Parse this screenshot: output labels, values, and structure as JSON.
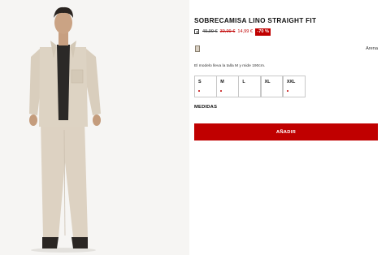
{
  "product": {
    "title": "SOBRECAMISA LINO STRAIGHT FIT",
    "price_original": "49,99 €",
    "price_previous": "39,99 €",
    "price_current": "14,99 €",
    "discount": "-70 %",
    "color_name": "Arena",
    "model_info": "El modelo lleva la talla M y mide 190cm."
  },
  "sizes": [
    {
      "label": "S",
      "low_stock": true
    },
    {
      "label": "M",
      "low_stock": true
    },
    {
      "label": "L",
      "low_stock": false
    },
    {
      "label": "XL",
      "low_stock": false
    },
    {
      "label": "XXL",
      "low_stock": true
    }
  ],
  "actions": {
    "measurements_label": "MEDIDAS",
    "add_to_cart_label": "AÑADIR"
  },
  "colors": {
    "accent": "#c00000",
    "swatch": "#d8cfc2"
  }
}
